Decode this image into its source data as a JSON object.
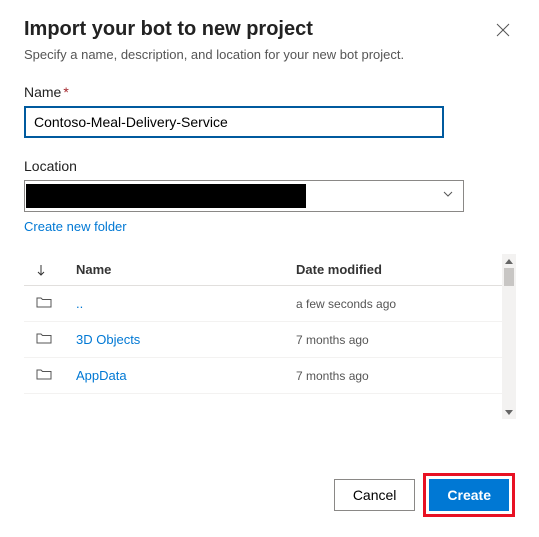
{
  "dialog": {
    "title": "Import your bot to new project",
    "subtitle": "Specify a name, description, and location for your new bot project."
  },
  "fields": {
    "name": {
      "label": "Name",
      "required_mark": "*",
      "value": "Contoso-Meal-Delivery-Service"
    },
    "location": {
      "label": "Location",
      "value": ""
    }
  },
  "links": {
    "create_folder": "Create new folder"
  },
  "table": {
    "headers": {
      "name": "Name",
      "date": "Date modified"
    },
    "rows": [
      {
        "name": "..",
        "date": "a few seconds ago"
      },
      {
        "name": "3D Objects",
        "date": "7 months ago"
      },
      {
        "name": "AppData",
        "date": "7 months ago"
      }
    ]
  },
  "footer": {
    "cancel": "Cancel",
    "create": "Create"
  }
}
